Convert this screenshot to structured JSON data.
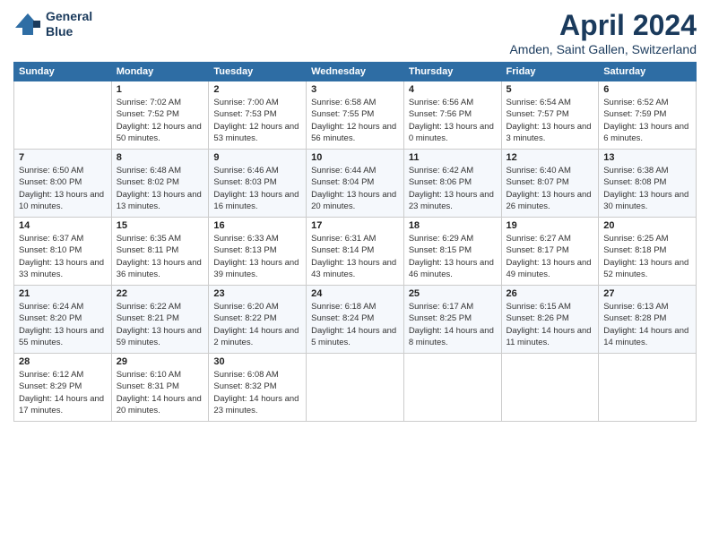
{
  "logo": {
    "line1": "General",
    "line2": "Blue"
  },
  "title": "April 2024",
  "subtitle": "Amden, Saint Gallen, Switzerland",
  "days_header": [
    "Sunday",
    "Monday",
    "Tuesday",
    "Wednesday",
    "Thursday",
    "Friday",
    "Saturday"
  ],
  "weeks": [
    [
      {
        "day": "",
        "sunrise": "",
        "sunset": "",
        "daylight": ""
      },
      {
        "day": "1",
        "sunrise": "Sunrise: 7:02 AM",
        "sunset": "Sunset: 7:52 PM",
        "daylight": "Daylight: 12 hours and 50 minutes."
      },
      {
        "day": "2",
        "sunrise": "Sunrise: 7:00 AM",
        "sunset": "Sunset: 7:53 PM",
        "daylight": "Daylight: 12 hours and 53 minutes."
      },
      {
        "day": "3",
        "sunrise": "Sunrise: 6:58 AM",
        "sunset": "Sunset: 7:55 PM",
        "daylight": "Daylight: 12 hours and 56 minutes."
      },
      {
        "day": "4",
        "sunrise": "Sunrise: 6:56 AM",
        "sunset": "Sunset: 7:56 PM",
        "daylight": "Daylight: 13 hours and 0 minutes."
      },
      {
        "day": "5",
        "sunrise": "Sunrise: 6:54 AM",
        "sunset": "Sunset: 7:57 PM",
        "daylight": "Daylight: 13 hours and 3 minutes."
      },
      {
        "day": "6",
        "sunrise": "Sunrise: 6:52 AM",
        "sunset": "Sunset: 7:59 PM",
        "daylight": "Daylight: 13 hours and 6 minutes."
      }
    ],
    [
      {
        "day": "7",
        "sunrise": "Sunrise: 6:50 AM",
        "sunset": "Sunset: 8:00 PM",
        "daylight": "Daylight: 13 hours and 10 minutes."
      },
      {
        "day": "8",
        "sunrise": "Sunrise: 6:48 AM",
        "sunset": "Sunset: 8:02 PM",
        "daylight": "Daylight: 13 hours and 13 minutes."
      },
      {
        "day": "9",
        "sunrise": "Sunrise: 6:46 AM",
        "sunset": "Sunset: 8:03 PM",
        "daylight": "Daylight: 13 hours and 16 minutes."
      },
      {
        "day": "10",
        "sunrise": "Sunrise: 6:44 AM",
        "sunset": "Sunset: 8:04 PM",
        "daylight": "Daylight: 13 hours and 20 minutes."
      },
      {
        "day": "11",
        "sunrise": "Sunrise: 6:42 AM",
        "sunset": "Sunset: 8:06 PM",
        "daylight": "Daylight: 13 hours and 23 minutes."
      },
      {
        "day": "12",
        "sunrise": "Sunrise: 6:40 AM",
        "sunset": "Sunset: 8:07 PM",
        "daylight": "Daylight: 13 hours and 26 minutes."
      },
      {
        "day": "13",
        "sunrise": "Sunrise: 6:38 AM",
        "sunset": "Sunset: 8:08 PM",
        "daylight": "Daylight: 13 hours and 30 minutes."
      }
    ],
    [
      {
        "day": "14",
        "sunrise": "Sunrise: 6:37 AM",
        "sunset": "Sunset: 8:10 PM",
        "daylight": "Daylight: 13 hours and 33 minutes."
      },
      {
        "day": "15",
        "sunrise": "Sunrise: 6:35 AM",
        "sunset": "Sunset: 8:11 PM",
        "daylight": "Daylight: 13 hours and 36 minutes."
      },
      {
        "day": "16",
        "sunrise": "Sunrise: 6:33 AM",
        "sunset": "Sunset: 8:13 PM",
        "daylight": "Daylight: 13 hours and 39 minutes."
      },
      {
        "day": "17",
        "sunrise": "Sunrise: 6:31 AM",
        "sunset": "Sunset: 8:14 PM",
        "daylight": "Daylight: 13 hours and 43 minutes."
      },
      {
        "day": "18",
        "sunrise": "Sunrise: 6:29 AM",
        "sunset": "Sunset: 8:15 PM",
        "daylight": "Daylight: 13 hours and 46 minutes."
      },
      {
        "day": "19",
        "sunrise": "Sunrise: 6:27 AM",
        "sunset": "Sunset: 8:17 PM",
        "daylight": "Daylight: 13 hours and 49 minutes."
      },
      {
        "day": "20",
        "sunrise": "Sunrise: 6:25 AM",
        "sunset": "Sunset: 8:18 PM",
        "daylight": "Daylight: 13 hours and 52 minutes."
      }
    ],
    [
      {
        "day": "21",
        "sunrise": "Sunrise: 6:24 AM",
        "sunset": "Sunset: 8:20 PM",
        "daylight": "Daylight: 13 hours and 55 minutes."
      },
      {
        "day": "22",
        "sunrise": "Sunrise: 6:22 AM",
        "sunset": "Sunset: 8:21 PM",
        "daylight": "Daylight: 13 hours and 59 minutes."
      },
      {
        "day": "23",
        "sunrise": "Sunrise: 6:20 AM",
        "sunset": "Sunset: 8:22 PM",
        "daylight": "Daylight: 14 hours and 2 minutes."
      },
      {
        "day": "24",
        "sunrise": "Sunrise: 6:18 AM",
        "sunset": "Sunset: 8:24 PM",
        "daylight": "Daylight: 14 hours and 5 minutes."
      },
      {
        "day": "25",
        "sunrise": "Sunrise: 6:17 AM",
        "sunset": "Sunset: 8:25 PM",
        "daylight": "Daylight: 14 hours and 8 minutes."
      },
      {
        "day": "26",
        "sunrise": "Sunrise: 6:15 AM",
        "sunset": "Sunset: 8:26 PM",
        "daylight": "Daylight: 14 hours and 11 minutes."
      },
      {
        "day": "27",
        "sunrise": "Sunrise: 6:13 AM",
        "sunset": "Sunset: 8:28 PM",
        "daylight": "Daylight: 14 hours and 14 minutes."
      }
    ],
    [
      {
        "day": "28",
        "sunrise": "Sunrise: 6:12 AM",
        "sunset": "Sunset: 8:29 PM",
        "daylight": "Daylight: 14 hours and 17 minutes."
      },
      {
        "day": "29",
        "sunrise": "Sunrise: 6:10 AM",
        "sunset": "Sunset: 8:31 PM",
        "daylight": "Daylight: 14 hours and 20 minutes."
      },
      {
        "day": "30",
        "sunrise": "Sunrise: 6:08 AM",
        "sunset": "Sunset: 8:32 PM",
        "daylight": "Daylight: 14 hours and 23 minutes."
      },
      {
        "day": "",
        "sunrise": "",
        "sunset": "",
        "daylight": ""
      },
      {
        "day": "",
        "sunrise": "",
        "sunset": "",
        "daylight": ""
      },
      {
        "day": "",
        "sunrise": "",
        "sunset": "",
        "daylight": ""
      },
      {
        "day": "",
        "sunrise": "",
        "sunset": "",
        "daylight": ""
      }
    ]
  ]
}
